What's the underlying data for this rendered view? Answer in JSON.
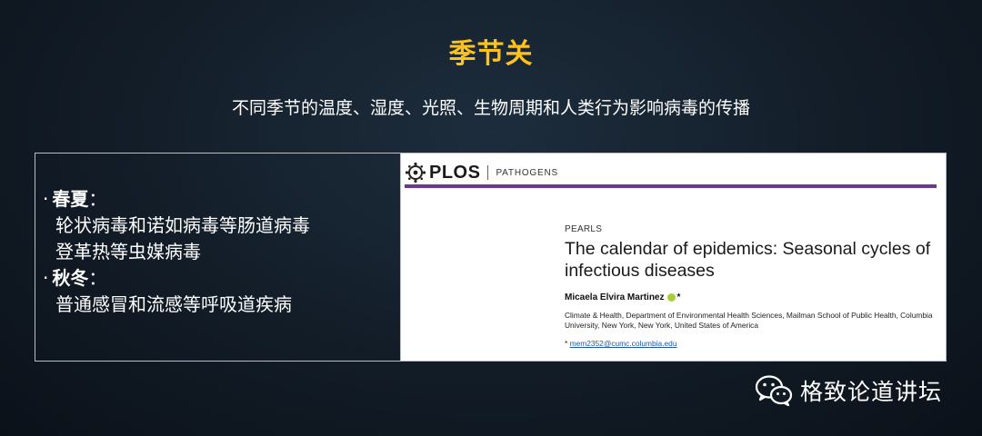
{
  "slide": {
    "title": "季节关",
    "subtitle": "不同季节的温度、湿度、光照、生物周期和人类行为影响病毒的传播"
  },
  "left_panel": {
    "bullet": "·",
    "groups": [
      {
        "heading": "春夏",
        "colon": "：",
        "items": [
          "轮状病毒和诺如病毒等肠道病毒",
          "登革热等虫媒病毒"
        ]
      },
      {
        "heading": "秋冬",
        "colon": "：",
        "items": [
          "普通感冒和流感等呼吸道疾病"
        ]
      }
    ]
  },
  "paper": {
    "publisher": "PLOS",
    "journal": "PATHOGENS",
    "accent_color": "#6b3a8c",
    "section": "PEARLS",
    "title": "The calendar of epidemics: Seasonal cycles of infectious diseases",
    "author": "Micaela Elvira Martinez",
    "author_mark": "*",
    "affiliation": "Climate & Health, Department of Environmental Health Sciences, Mailman School of Public Health, Columbia University, New York, New York, United States of America",
    "email_prefix": "*",
    "email": "mem2352@cumc.columbia.edu"
  },
  "branding": {
    "icon": "wechat-icon",
    "name": "格致论道讲坛"
  },
  "colors": {
    "title": "#ffc21a",
    "background": "#121c27"
  }
}
